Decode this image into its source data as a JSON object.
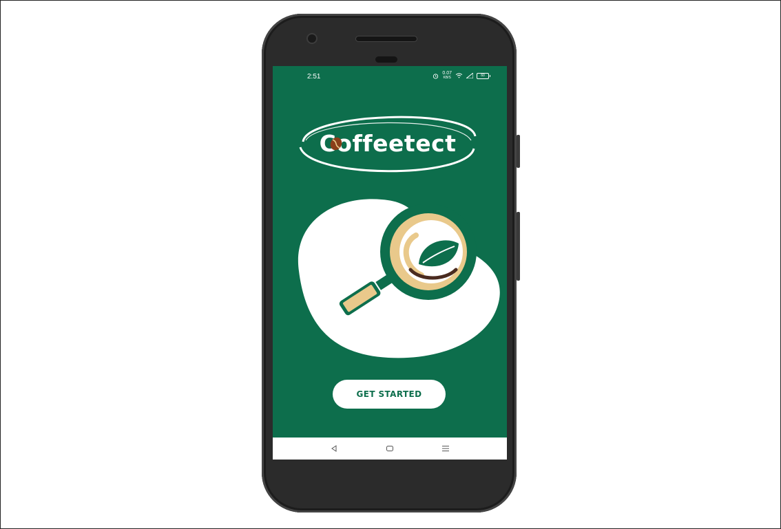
{
  "status_bar": {
    "time": "2:51",
    "speed_value": "0.07",
    "speed_unit": "KB/S",
    "battery": "60"
  },
  "app": {
    "name": "Coffeetect",
    "cta_label": "GET STARTED"
  },
  "colors": {
    "primary_green": "#0d6e4c",
    "accent_tan": "#e9c98b",
    "white": "#ffffff"
  },
  "nav_icons": [
    "back-icon",
    "home-icon",
    "menu-icon"
  ]
}
